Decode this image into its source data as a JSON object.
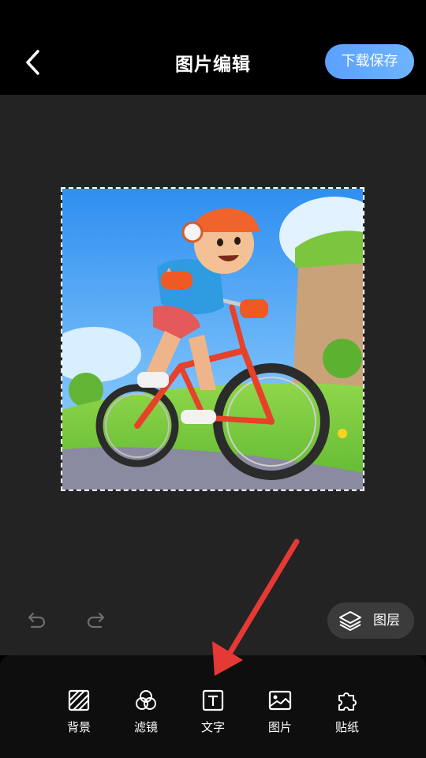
{
  "header": {
    "title": "图片编辑",
    "save_label": "下载保存"
  },
  "canvas": {
    "layers_label": "图层"
  },
  "toolbar": {
    "items": [
      {
        "label": "背景",
        "icon": "background-icon"
      },
      {
        "label": "滤镜",
        "icon": "filter-icon"
      },
      {
        "label": "文字",
        "icon": "text-icon"
      },
      {
        "label": "图片",
        "icon": "image-icon"
      },
      {
        "label": "贴纸",
        "icon": "sticker-icon"
      }
    ]
  },
  "colors": {
    "accent": "#5aa0ff",
    "background": "#000000",
    "canvas_bg": "#232323",
    "annotation_arrow": "#e53935"
  }
}
